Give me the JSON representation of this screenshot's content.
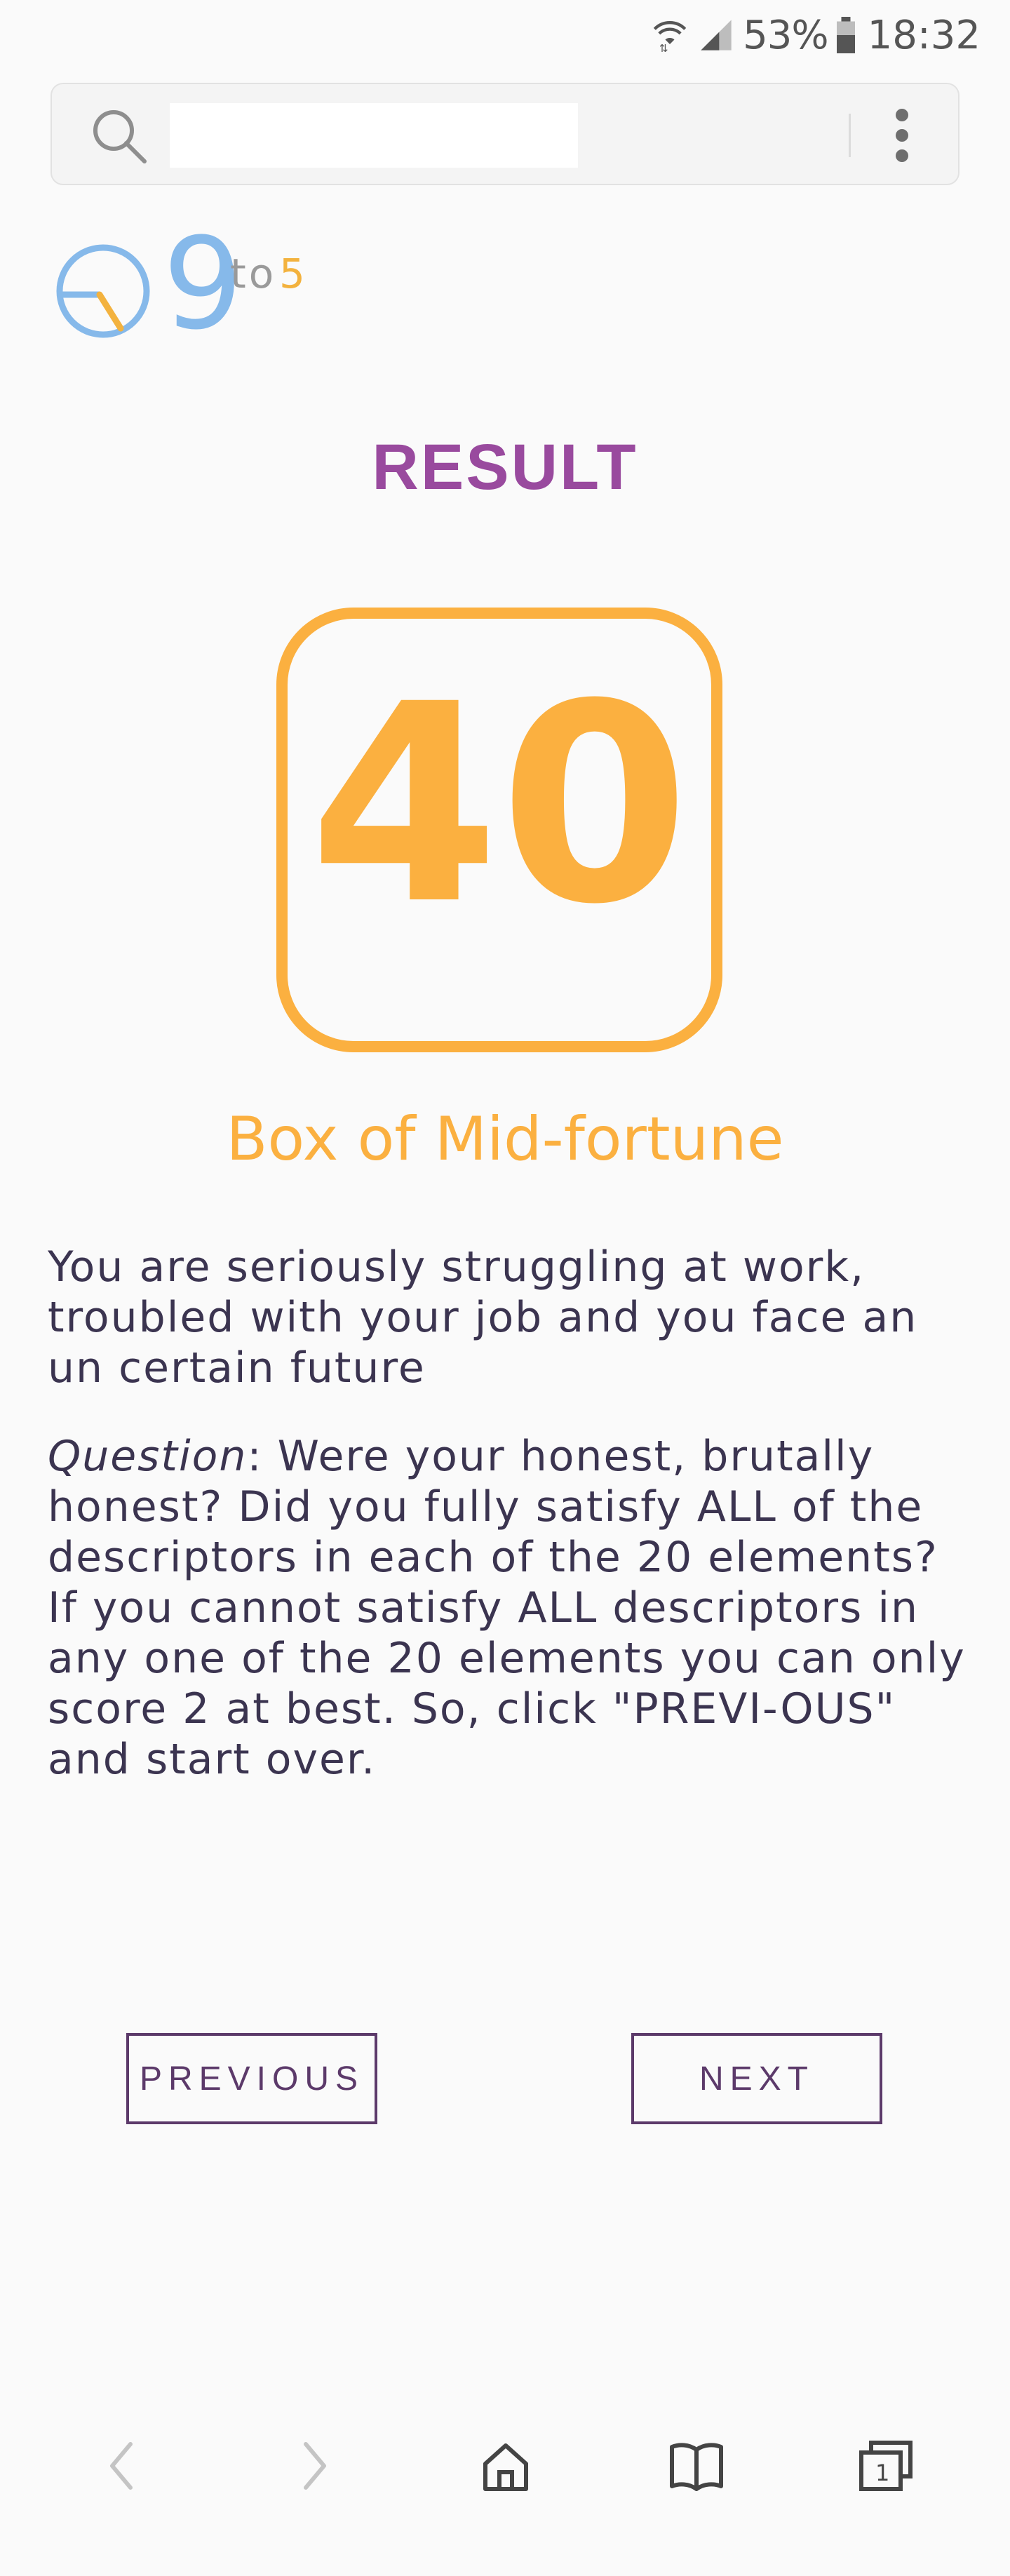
{
  "status_bar": {
    "battery_percent": "53%",
    "time": "18:32"
  },
  "search": {
    "value": "",
    "placeholder": ""
  },
  "logo": {
    "number": "9",
    "to": "to",
    "five": "5"
  },
  "result": {
    "title": "RESULT",
    "score": "40",
    "tier": "Box of Mid-fortune",
    "description": "You are seriously struggling at work, troubled with your job and you face an un certain future",
    "question_label": "Question",
    "question_text": ": Were your honest, brutally honest? Did you fully satisfy ALL of the descriptors in each of the 20 elements? If you cannot satisfy ALL descriptors in any one of the 20 elements you can only score 2 at best. So, click \"PREVI-OUS\" and start over."
  },
  "buttons": {
    "previous": "PREVIOUS",
    "next": "NEXT"
  },
  "colors": {
    "accent_purple": "#994a9e",
    "score_orange": "#fbb040",
    "button_border": "#5c3a6a",
    "text": "#3b3450"
  },
  "icons": {
    "wifi": "wifi-icon",
    "signal": "signal-icon",
    "battery": "battery-icon",
    "search": "search-icon",
    "menu": "more-vert-icon",
    "back": "chevron-left-icon",
    "forward": "chevron-right-icon",
    "home": "home-icon",
    "bookmarks": "book-icon",
    "tabs": "tabs-icon"
  }
}
